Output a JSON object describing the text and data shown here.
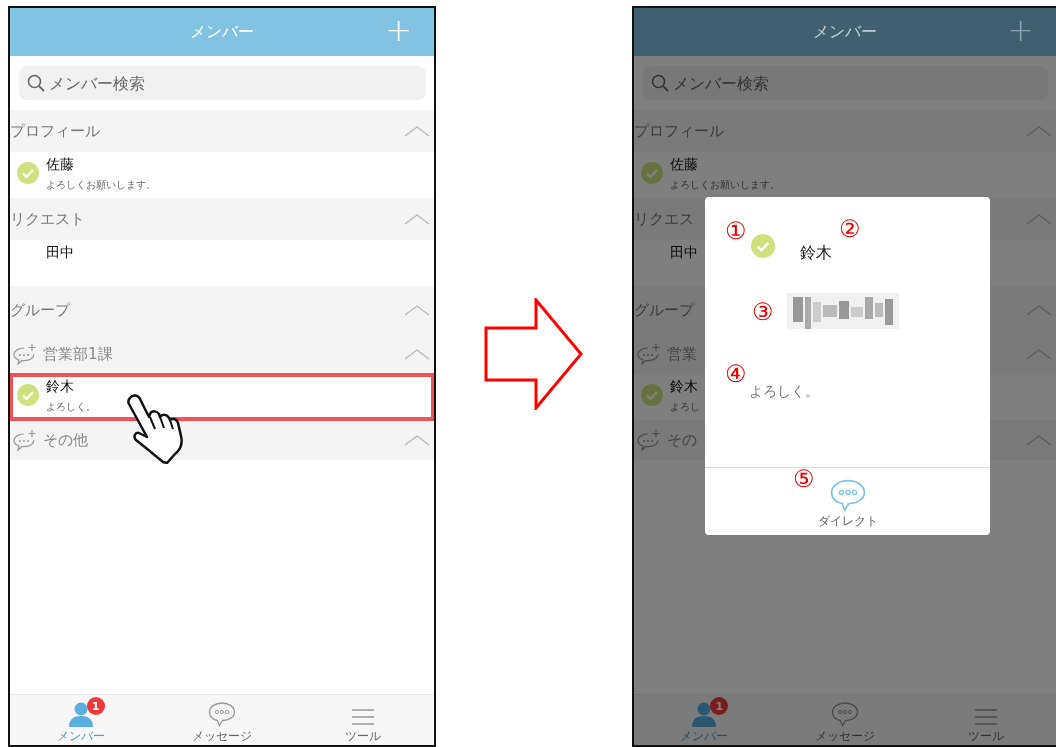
{
  "left_screen": {
    "dimmed": false,
    "header": {
      "title": "メンバー",
      "add": "+"
    },
    "search": {
      "placeholder": "メンバー検索"
    },
    "list": [
      {
        "kind": "section",
        "label": "プロフィール"
      },
      {
        "kind": "member",
        "name": "佐藤",
        "message": "よろしくお願いします。",
        "verified": true,
        "highlighted": false
      },
      {
        "kind": "section",
        "label": "リクエスト"
      },
      {
        "kind": "member",
        "name": "田中",
        "verified": false,
        "highlighted": false
      },
      {
        "kind": "section",
        "label": "グループ"
      },
      {
        "kind": "group",
        "label": "営業部1課"
      },
      {
        "kind": "member",
        "name": "鈴木",
        "message": "よろしく。",
        "verified": true,
        "highlighted": true
      },
      {
        "kind": "group",
        "label": "その他"
      }
    ],
    "tabs": [
      {
        "label": "メンバー",
        "kind": "person",
        "selected": true,
        "badge": "1"
      },
      {
        "label": "メッセージ",
        "kind": "chat",
        "selected": false
      },
      {
        "label": "ツール",
        "kind": "menu",
        "selected": false
      }
    ]
  },
  "right_screen": {
    "dimmed": true,
    "header": {
      "title": "メンバー",
      "add": "+"
    },
    "search": {
      "placeholder": "メンバー検索"
    },
    "list": [
      {
        "kind": "section",
        "label": "プロフィール"
      },
      {
        "kind": "member",
        "name": "佐藤",
        "message": "よろしくお願いします。",
        "verified": true,
        "highlighted": false
      },
      {
        "kind": "section",
        "label": "リクエス"
      },
      {
        "kind": "member",
        "name": "田中",
        "verified": false,
        "highlighted": false
      },
      {
        "kind": "section",
        "label": "グループ"
      },
      {
        "kind": "group",
        "label": "営業"
      },
      {
        "kind": "member",
        "name": "鈴木",
        "message": "よろし",
        "verified": true,
        "highlighted": false
      },
      {
        "kind": "group",
        "label": "その"
      }
    ],
    "tabs": [
      {
        "label": "メンバー",
        "kind": "person",
        "selected": true,
        "badge": "1"
      },
      {
        "label": "メッセージ",
        "kind": "chat",
        "selected": false
      },
      {
        "label": "ツール",
        "kind": "menu",
        "selected": false
      }
    ],
    "modal": {
      "name": "鈴木",
      "verified": true,
      "message": "よろしく。",
      "action": "ダイレクト",
      "annotations": [
        "①",
        "②",
        "③",
        "④",
        "⑤"
      ]
    }
  }
}
